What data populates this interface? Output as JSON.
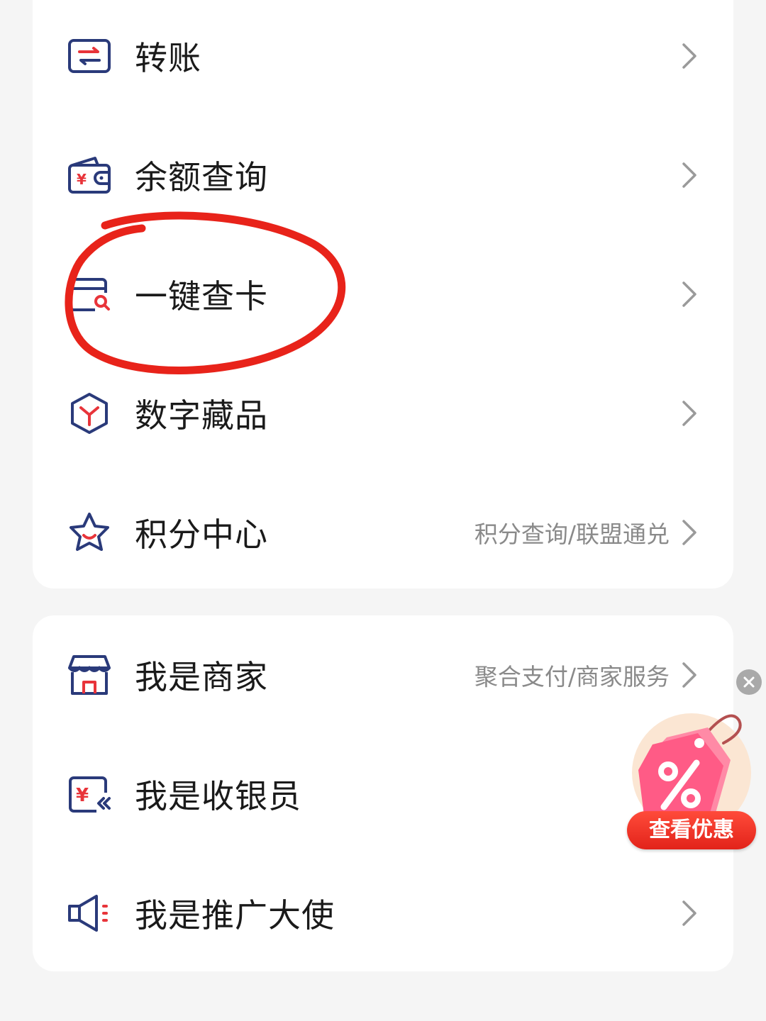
{
  "menu_group_1": {
    "items": [
      {
        "label": "转账",
        "icon": "transfer-icon",
        "sub": ""
      },
      {
        "label": "余额查询",
        "icon": "wallet-icon",
        "sub": ""
      },
      {
        "label": "一键查卡",
        "icon": "card-search-icon",
        "sub": ""
      },
      {
        "label": "数字藏品",
        "icon": "cube-icon",
        "sub": ""
      },
      {
        "label": "积分中心",
        "icon": "star-icon",
        "sub": "积分查询/联盟通兑"
      }
    ]
  },
  "menu_group_2": {
    "items": [
      {
        "label": "我是商家",
        "icon": "store-icon",
        "sub": "聚合支付/商家服务"
      },
      {
        "label": "我是收银员",
        "icon": "cashier-icon",
        "sub": ""
      },
      {
        "label": "我是推广大使",
        "icon": "megaphone-icon",
        "sub": ""
      }
    ]
  },
  "promo": {
    "label": "查看优惠",
    "icon": "discount-tag-icon"
  },
  "colors": {
    "icon_navy": "#2a3a7a",
    "icon_red": "#e8343a",
    "annotation_red": "#e8231a",
    "promo_red": "#e2231a"
  }
}
